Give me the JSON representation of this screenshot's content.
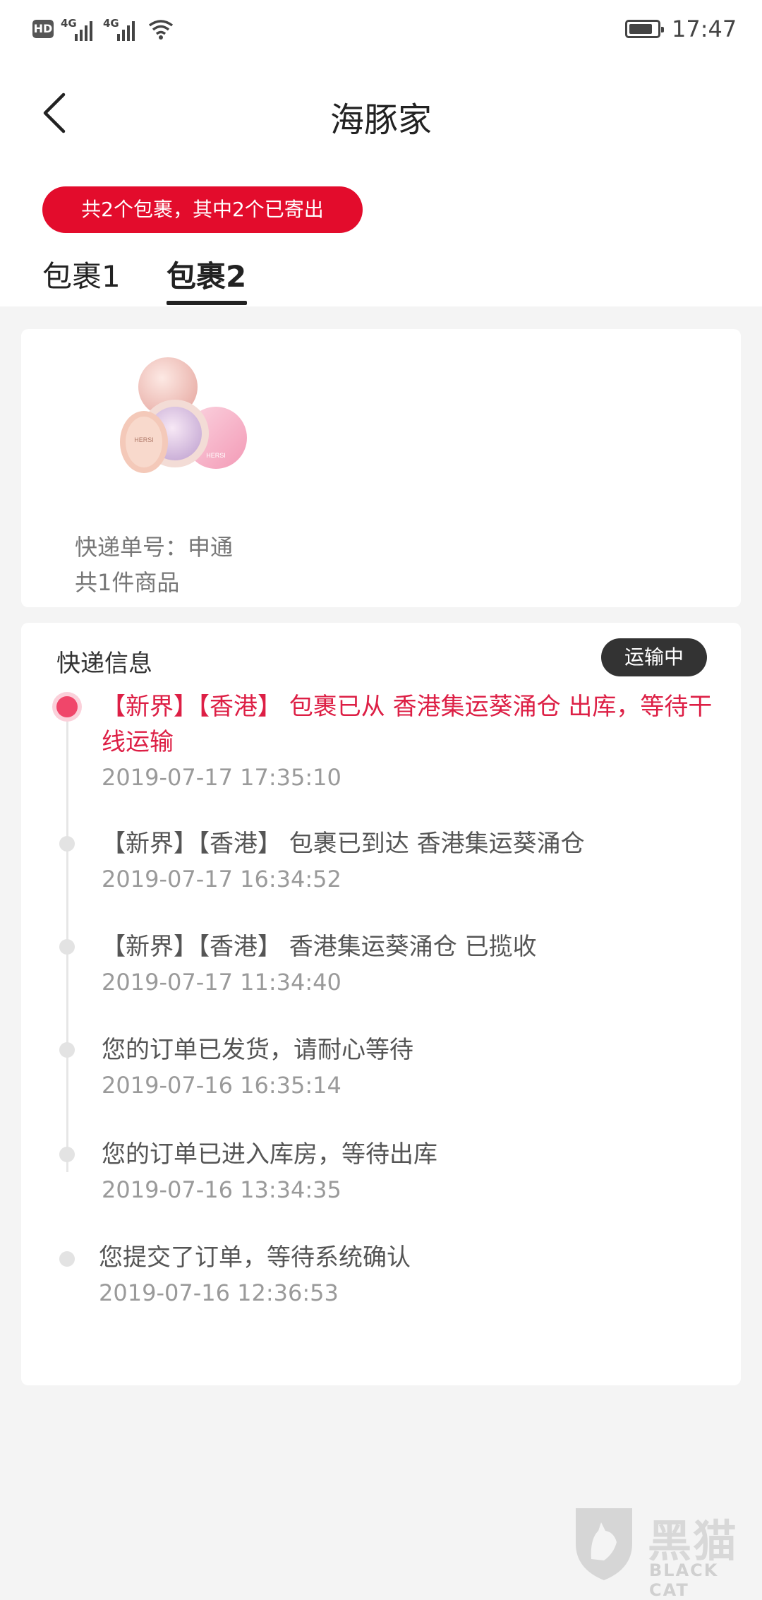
{
  "status_bar": {
    "hd": "HD",
    "network1": "4G",
    "network2": "4G",
    "battery_level": 0.85,
    "time": "17:47"
  },
  "header": {
    "title": "海豚家",
    "back_icon": "chevron-left-icon"
  },
  "summary_pill": "共2个包裹，其中2个已寄出",
  "tabs": [
    {
      "label": "包裹1",
      "active": false
    },
    {
      "label": "包裹2",
      "active": true
    }
  ],
  "package": {
    "product_image": "cosmetic-powder-compact",
    "courier_line": "快递单号：申通",
    "item_count": "共1件商品"
  },
  "tracking": {
    "title": "快递信息",
    "status_badge": "运输中",
    "events": [
      {
        "text": "【新界】【香港】 包裹已从 香港集运葵涌仓 出库，等待干线运输",
        "time": "2019-07-17 17:35:10",
        "active": true
      },
      {
        "text": "【新界】【香港】 包裹已到达 香港集运葵涌仓",
        "time": "2019-07-17 16:34:52",
        "active": false
      },
      {
        "text": "【新界】【香港】 香港集运葵涌仓 已揽收",
        "time": "2019-07-17 11:34:40",
        "active": false
      },
      {
        "text": "您的订单已发货，请耐心等待",
        "time": "2019-07-16 16:35:14",
        "active": false
      },
      {
        "text": "您的订单已进入库房，等待出库",
        "time": "2019-07-16 13:34:35",
        "active": false
      },
      {
        "text": "您提交了订单，等待系统确认",
        "time": "2019-07-16 12:36:53",
        "active": false
      }
    ]
  },
  "watermark": {
    "cn": "黑猫",
    "en": "BLACK CAT"
  },
  "colors": {
    "accent": "#e30c2c",
    "active_event": "#dd1f45",
    "badge_bg": "#333333"
  }
}
